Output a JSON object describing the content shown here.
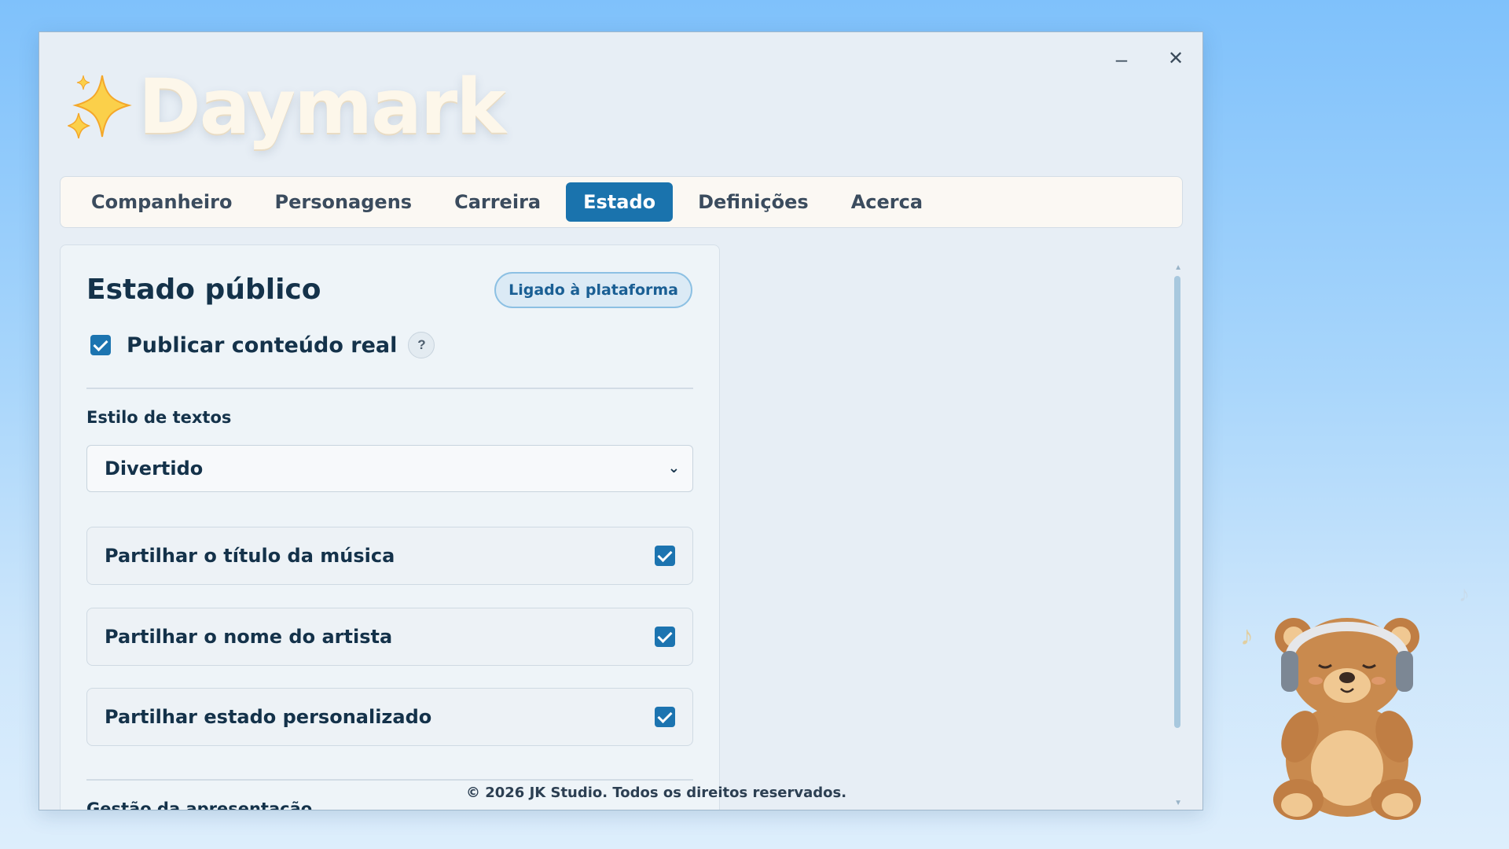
{
  "app": {
    "title": "Daymark"
  },
  "window_controls": {
    "minimize": "–",
    "close": "✕"
  },
  "tabs": [
    {
      "label": "Companheiro",
      "active": false
    },
    {
      "label": "Personagens",
      "active": false
    },
    {
      "label": "Carreira",
      "active": false
    },
    {
      "label": "Estado",
      "active": true
    },
    {
      "label": "Definições",
      "active": false
    },
    {
      "label": "Acerca",
      "active": false
    }
  ],
  "status": {
    "title": "Estado público",
    "badge": "Ligado à plataforma",
    "publish_label": "Publicar conteúdo real",
    "publish_checked": true,
    "help": "?",
    "text_style_label": "Estilo de textos",
    "text_style_value": "Divertido",
    "options": [
      {
        "label": "Partilhar o título da música",
        "checked": true
      },
      {
        "label": "Partilhar o nome do artista",
        "checked": true
      },
      {
        "label": "Partilhar estado personalizado",
        "checked": true
      }
    ],
    "next_section_label": "Gestão da apresentação"
  },
  "footer": "© 2026 JK Studio. Todos os direitos reservados.",
  "colors": {
    "accent": "#1a73ad",
    "text": "#14324a",
    "background_top": "#7fc1fb"
  },
  "icons": [
    "sparkle-icon",
    "minimize-icon",
    "close-icon",
    "help-icon",
    "chevron-down-icon",
    "checkbox-icon",
    "bear-mascot",
    "music-note-icon"
  ]
}
